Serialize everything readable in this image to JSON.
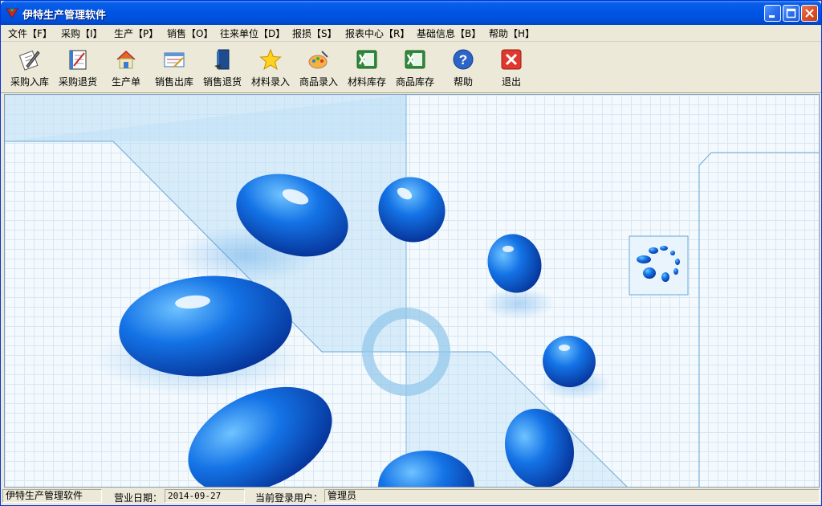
{
  "window": {
    "title": "伊特生产管理软件",
    "controls": [
      "minimize",
      "maximize",
      "close"
    ]
  },
  "menu": [
    {
      "label": "文件【F】"
    },
    {
      "label": "采购【I】"
    },
    {
      "label": "生产【P】"
    },
    {
      "label": "销售【O】"
    },
    {
      "label": "往来单位【D】"
    },
    {
      "label": "报损【S】"
    },
    {
      "label": "报表中心【R】"
    },
    {
      "label": "基础信息【B】"
    },
    {
      "label": "帮助【H】"
    }
  ],
  "toolbar": [
    {
      "label": "采购入库",
      "icon": "pen-document-icon"
    },
    {
      "label": "采购退货",
      "icon": "notebook-icon"
    },
    {
      "label": "生产单",
      "icon": "house-icon"
    },
    {
      "label": "销售出库",
      "icon": "form-icon"
    },
    {
      "label": "销售退货",
      "icon": "book-icon"
    },
    {
      "label": "材料录入",
      "icon": "star-icon"
    },
    {
      "label": "商品录入",
      "icon": "palette-icon"
    },
    {
      "label": "材料库存",
      "icon": "excel-icon"
    },
    {
      "label": "商品库存",
      "icon": "excel-icon"
    },
    {
      "label": "帮助",
      "icon": "help-icon"
    },
    {
      "label": "退出",
      "icon": "exit-icon"
    }
  ],
  "statusbar": {
    "app_name": "伊特生产管理软件",
    "business_date_label": "营业日期：",
    "business_date": "2014-09-27",
    "current_user_label": "当前登录用户：",
    "current_user": "管理员"
  },
  "colors": {
    "titlebar": "#0055E5",
    "accent_blue": "#1473E6",
    "panel": "#ECE9D8"
  }
}
